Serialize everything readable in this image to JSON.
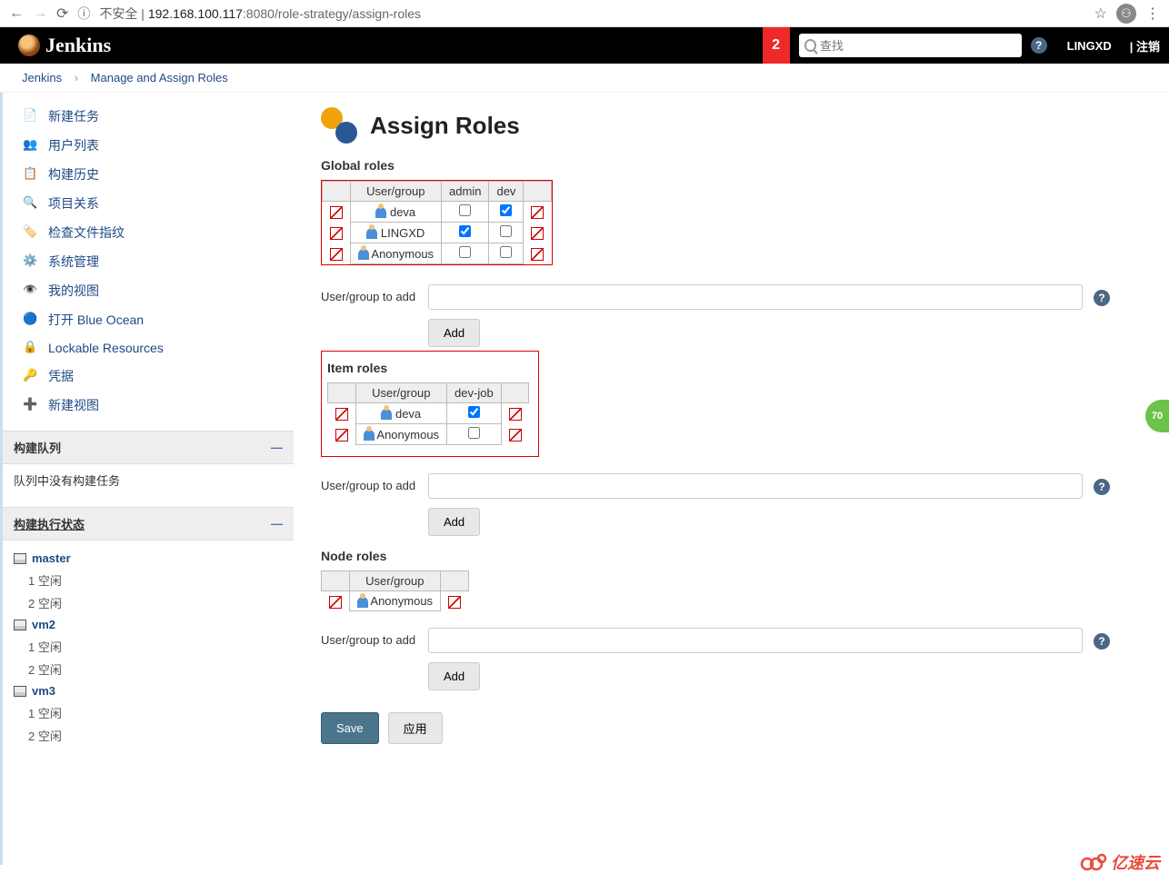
{
  "browser": {
    "unsafe": "不安全",
    "url_host": "192.168.100.117",
    "url_port": ":8080",
    "url_path": "/role-strategy/assign-roles",
    "info_icon": "ⓘ"
  },
  "header": {
    "brand": "Jenkins",
    "badge": "2",
    "search_placeholder": "查找",
    "user": "LINGXD",
    "logout": "| 注销"
  },
  "breadcrumbs": {
    "home": "Jenkins",
    "current": "Manage and Assign Roles"
  },
  "sidebar": {
    "tasks": [
      {
        "label": "新建任务"
      },
      {
        "label": "用户列表"
      },
      {
        "label": "构建历史"
      },
      {
        "label": "项目关系"
      },
      {
        "label": "检查文件指纹"
      },
      {
        "label": "系统管理"
      },
      {
        "label": "我的视图"
      },
      {
        "label": "打开 Blue Ocean"
      },
      {
        "label": "Lockable Resources"
      },
      {
        "label": "凭据"
      },
      {
        "label": "新建视图"
      }
    ],
    "queue": {
      "title": "构建队列",
      "empty": "队列中没有构建任务"
    },
    "executors": {
      "title": "构建执行状态",
      "nodes": [
        {
          "name": "master",
          "slots": [
            {
              "n": "1",
              "s": "空闲"
            },
            {
              "n": "2",
              "s": "空闲"
            }
          ]
        },
        {
          "name": "vm2",
          "slots": [
            {
              "n": "1",
              "s": "空闲"
            },
            {
              "n": "2",
              "s": "空闲"
            }
          ]
        },
        {
          "name": "vm3",
          "slots": [
            {
              "n": "1",
              "s": "空闲"
            },
            {
              "n": "2",
              "s": "空闲"
            }
          ]
        }
      ]
    }
  },
  "main": {
    "title": "Assign Roles",
    "global": {
      "heading": "Global roles",
      "header_user": "User/group",
      "cols": [
        "admin",
        "dev"
      ],
      "rows": [
        {
          "name": "deva",
          "checks": [
            false,
            true
          ]
        },
        {
          "name": "LINGXD",
          "checks": [
            true,
            false
          ]
        },
        {
          "name": "Anonymous",
          "checks": [
            false,
            false
          ]
        }
      ]
    },
    "item": {
      "heading": "Item roles",
      "header_user": "User/group",
      "cols": [
        "dev-job"
      ],
      "rows": [
        {
          "name": "deva",
          "checks": [
            true
          ]
        },
        {
          "name": "Anonymous",
          "checks": [
            false
          ]
        }
      ]
    },
    "node": {
      "heading": "Node roles",
      "header_user": "User/group",
      "rows": [
        {
          "name": "Anonymous"
        }
      ]
    },
    "add_label": "User/group to add",
    "add_btn": "Add",
    "save": "Save",
    "apply": "应用"
  },
  "floater": "70",
  "watermark": "亿速云"
}
